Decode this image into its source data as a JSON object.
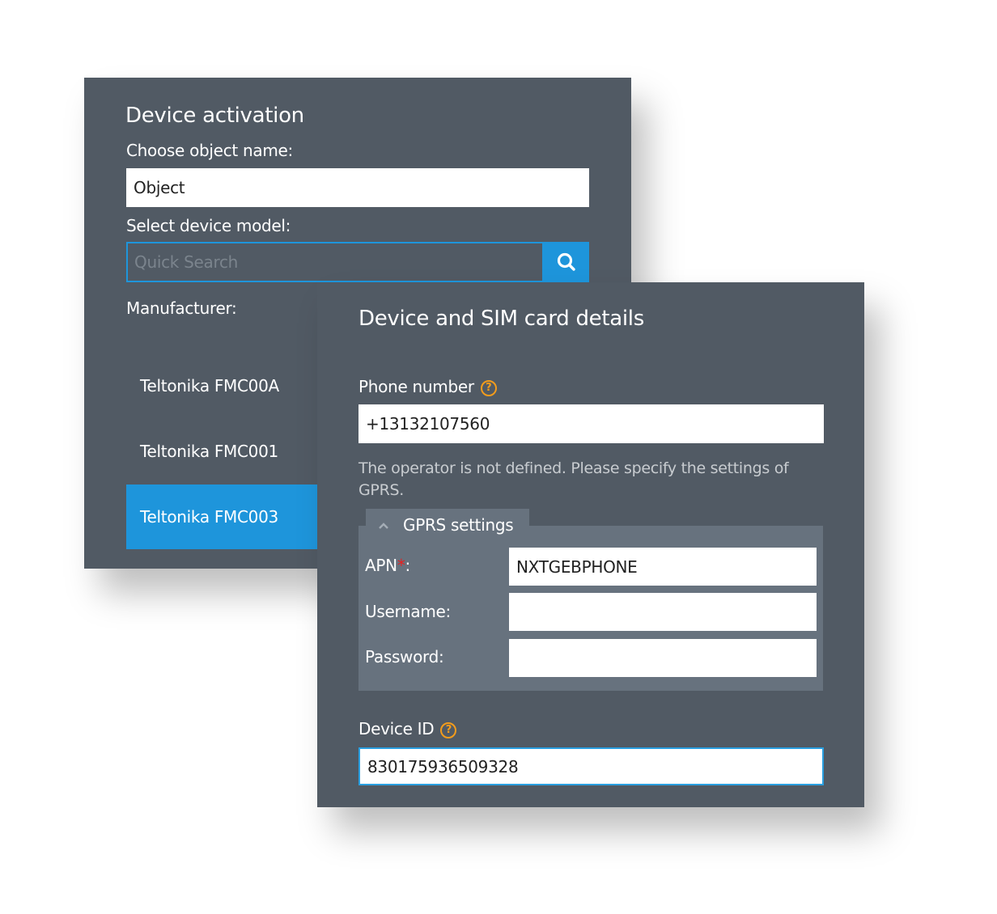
{
  "activation": {
    "title": "Device activation",
    "object_name_label": "Choose object name:",
    "object_name_value": "Object",
    "device_model_label": "Select device model:",
    "search_placeholder": "Quick Search",
    "search_icon": "search-icon",
    "manufacturer_label": "Manufacturer:",
    "devices": [
      {
        "label": "Teltonika FMC00A",
        "selected": false
      },
      {
        "label": "Teltonika FMC001",
        "selected": false
      },
      {
        "label": "Teltonika FMC003",
        "selected": true
      }
    ]
  },
  "sim": {
    "title": "Device and SIM card details",
    "phone_label": "Phone number",
    "phone_value": "+13132107560",
    "help_icon": "?",
    "operator_hint": "The operator is not defined. Please specify the settings of GPRS.",
    "gprs": {
      "tab_label": "GPRS settings",
      "collapse_icon": "chevron-up-icon",
      "apn_label": "APN",
      "apn_required_mark": "*",
      "apn_suffix": ":",
      "apn_value": "NXTGEBPHONE",
      "username_label": "Username:",
      "username_value": "",
      "password_label": "Password:",
      "password_value": ""
    },
    "device_id_label": "Device ID",
    "device_id_value": "830175936509328"
  },
  "colors": {
    "panel_bg": "#515a64",
    "accent": "#1e95db",
    "help": "#f39c1c",
    "required": "#e62020",
    "gprs_bg": "#67727e"
  }
}
